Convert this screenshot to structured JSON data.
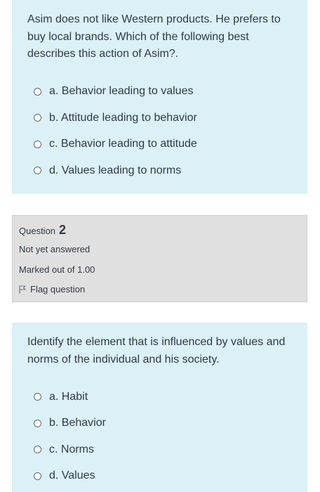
{
  "question1": {
    "text": "Asim does not like Western products. He prefers to buy local brands. Which of the following best describes this action of Asim?.",
    "answers": [
      "a. Behavior leading to values",
      "b. Attitude leading to behavior",
      "c. Behavior leading to attitude",
      "d. Values leading to norms"
    ]
  },
  "question2_info": {
    "label": "Question",
    "number": "2",
    "status": "Not yet answered",
    "marked": "Marked out of 1.00",
    "flag": "Flag question"
  },
  "question2": {
    "text": "Identify the element that is influenced by values and norms of the individual and his society.",
    "answers": [
      "a. Habit",
      "b. Behavior",
      "c. Norms",
      "d. Values"
    ]
  }
}
